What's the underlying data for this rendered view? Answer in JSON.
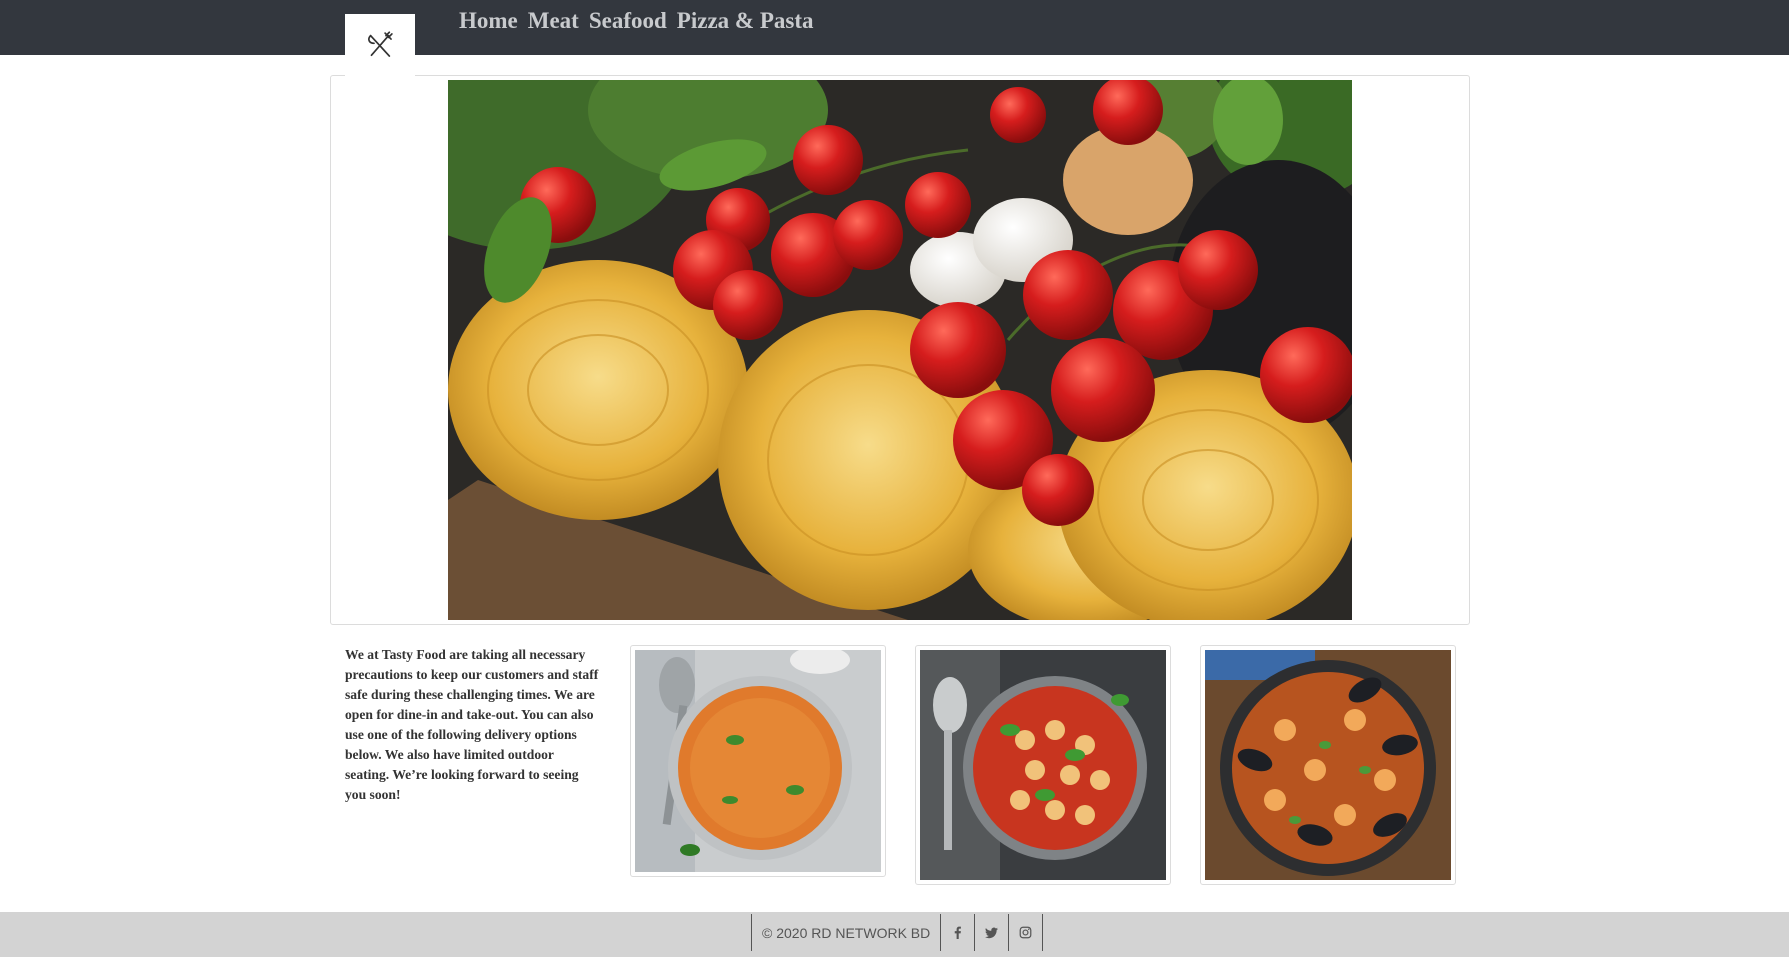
{
  "nav": {
    "logo_icon": "fork-knife-icon",
    "items": [
      "Home",
      "Meat",
      "Seafood",
      "Pizza & Pasta"
    ]
  },
  "hero": {
    "image": "fresh-pasta-tomatoes-photo"
  },
  "intro": {
    "text": "We at Tasty Food are taking all necessary precautions to keep our customers and staff safe during these challenging times. We are open for dine-in and take-out. You can also use one of the following delivery options below. We also have limited outdoor seating. We’re looking forward to seeing you soon!"
  },
  "gallery": [
    {
      "image": "tomato-risotto-pot-photo"
    },
    {
      "image": "gnocchi-tomato-basil-pan-photo"
    },
    {
      "image": "seafood-paella-mussels-photo"
    }
  ],
  "footer": {
    "copyright": "© 2020 RD NETWORK BD",
    "social": [
      "facebook-icon",
      "twitter-icon",
      "instagram-icon"
    ]
  },
  "colors": {
    "navbar": "#33373e",
    "nav_text": "#c8cacd",
    "footer": "#d3d3d3"
  }
}
